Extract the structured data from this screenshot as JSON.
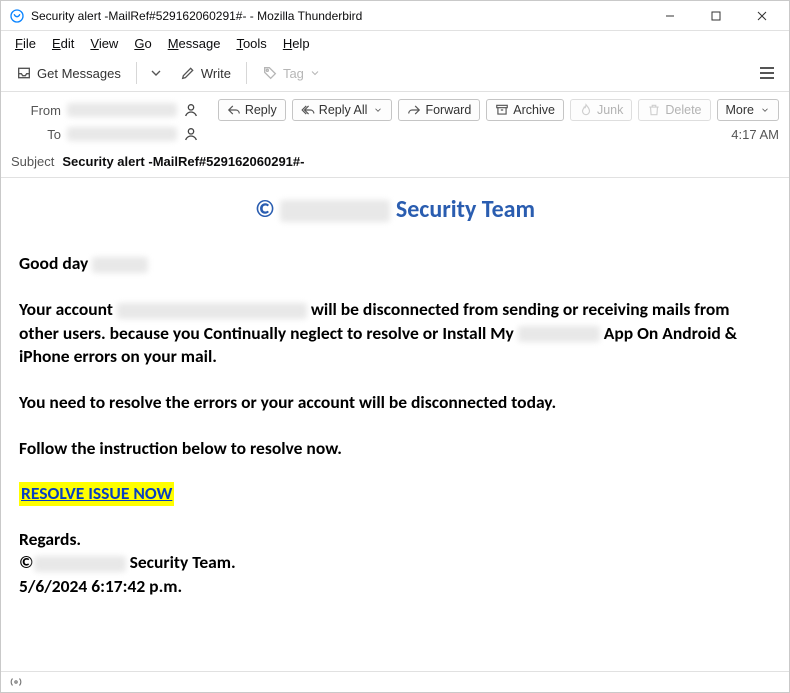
{
  "window": {
    "title": "Security alert -MailRef#529162060291#- - Mozilla Thunderbird"
  },
  "menubar": [
    "File",
    "Edit",
    "View",
    "Go",
    "Message",
    "Tools",
    "Help"
  ],
  "toolbar": {
    "get_messages": "Get Messages",
    "write": "Write",
    "tag": "Tag",
    "hamburger": "Application Menu"
  },
  "actions": {
    "reply": "Reply",
    "reply_all": "Reply All",
    "forward": "Forward",
    "archive": "Archive",
    "junk": "Junk",
    "delete": "Delete",
    "more": "More"
  },
  "header": {
    "from_label": "From",
    "from_value": "redacted@example.com",
    "to_label": "To",
    "to_value": "redacted@example.com",
    "subject_label": "Subject",
    "subject": "Security alert -MailRef#529162060291#-",
    "time": "4:17 AM"
  },
  "body": {
    "heading_prefix": "©",
    "heading_brand": "Brand",
    "heading_suffix": " Security Team",
    "greeting_prefix": "Good day ",
    "greeting_name": "name",
    "para1_a": "Your account ",
    "para1_account": "redacted@example",
    "para1_b": " will be disconnected from sending or receiving mails from other users. because you  Continually  neglect to resolve or Install My ",
    "para1_brand": "Brand",
    "para1_c": " App On Android & iPhone errors on your mail.",
    "para2": "You need to resolve the errors or your account will be disconnected today.",
    "para3": "Follow the instruction below to resolve now.",
    "resolve_link": "RESOLVE ISSUE NOW",
    "sign_regards": "Regards.",
    "sign_line_a": "©",
    "sign_line_brand": "Brand",
    "sign_line_b": "Security Team.",
    "sign_date": "5/6/2024 6:17:42 p.m."
  }
}
